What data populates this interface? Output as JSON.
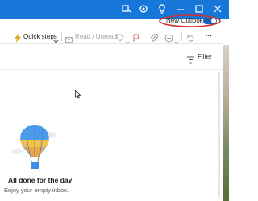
{
  "titlebar": {
    "icons": [
      "pin-icon",
      "gear-icon",
      "lightbulb-icon",
      "minimize-icon",
      "maximize-icon",
      "close-icon"
    ],
    "accent_color": "#1677d9",
    "new_outlook_label": "New Outlook",
    "new_outlook_enabled": true
  },
  "toolbar": {
    "quick_steps_label": "Quick steps",
    "read_unread_label": "Read / Unread",
    "more_label": "···"
  },
  "filter": {
    "label": "Filter"
  },
  "empty_state": {
    "title": "All done for the day",
    "subtitle": "Enjoy your empty inbox."
  }
}
